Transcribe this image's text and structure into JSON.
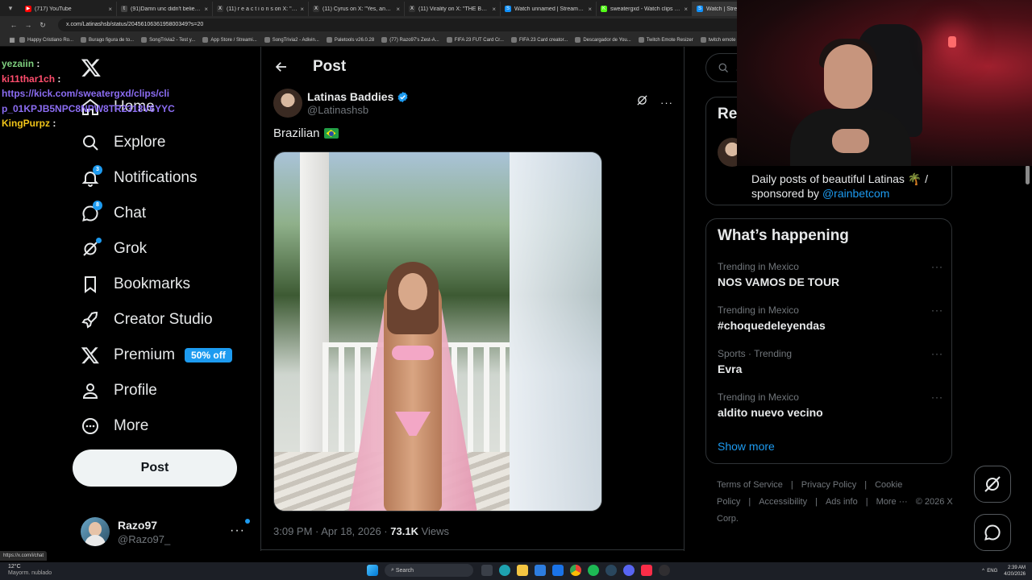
{
  "browser": {
    "tabs": [
      {
        "title": "(717) YouTube",
        "color": "#ff0000",
        "glyph": "▶"
      },
      {
        "title": "(91)Damn unc didn't believe in",
        "color": "#444444",
        "glyph": "t"
      },
      {
        "title": "(11) r e a c t i o n s on X: \"El cro",
        "color": "#333333",
        "glyph": "X"
      },
      {
        "title": "(11) Cyrus on X: \"Yes, and it'd",
        "color": "#333333",
        "glyph": "X"
      },
      {
        "title": "(11) Virality on X: \"THE BOTT",
        "color": "#333333",
        "glyph": "X"
      },
      {
        "title": "Watch unnamed | Streamable",
        "color": "#0f90fa",
        "glyph": "S"
      },
      {
        "title": "sweatergxd - Watch clips on K",
        "color": "#53fc18",
        "glyph": "K"
      },
      {
        "title": "Watch | Streama",
        "color": "#0f90fa",
        "glyph": "S"
      }
    ],
    "url": "x.com/Latinashsb/status/2045610636195800349?s=20",
    "bookmarks": [
      "Happy Cristiano Ro...",
      "Burago figura de to...",
      "SongTrivia2 - Test y...",
      "App Store / Streami...",
      "SongTrivia2 - Adivin...",
      "Paletools v26.0.28",
      "(77) Razo97's Zest-A...",
      "FIFA 23 FUT Card Cr...",
      "FIFA 23 Card creator...",
      "Descargador de You...",
      "Twitch Emote Resizer",
      "twitch emote re"
    ]
  },
  "chat": {
    "messages": [
      {
        "user": "yezaiin",
        "text": ":",
        "style": "u1"
      },
      {
        "user": "ki11thar1ch",
        "text": ":",
        "style": "u2"
      },
      {
        "user": "",
        "text": "https://kick.com/sweatergxd/clips/clip_01KPJB5NPC8NPW8TR2318V6YYC",
        "style": "link"
      },
      {
        "user": "KingPurpz",
        "text": ":",
        "style": "u3"
      }
    ]
  },
  "nav": {
    "items": [
      {
        "label": "Home",
        "icon": "home-icon"
      },
      {
        "label": "Explore",
        "icon": "search-icon"
      },
      {
        "label": "Notifications",
        "icon": "bell-icon",
        "badge": "3"
      },
      {
        "label": "Chat",
        "icon": "chat-icon",
        "badge": "8"
      },
      {
        "label": "Grok",
        "icon": "grok-icon"
      },
      {
        "label": "Bookmarks",
        "icon": "bookmark-icon"
      },
      {
        "label": "Creator Studio",
        "icon": "rocket-icon"
      },
      {
        "label": "Premium",
        "icon": "x-icon",
        "pill": "50% off"
      },
      {
        "label": "Profile",
        "icon": "person-icon"
      },
      {
        "label": "More",
        "icon": "more-circle-icon"
      }
    ],
    "post_button": "Post",
    "account": {
      "name": "Razo97",
      "handle": "@Razo97_"
    }
  },
  "post": {
    "header_title": "Post",
    "author_name": "Latinas Baddies",
    "author_handle": "@Latinashsb",
    "text": "Brazilian",
    "time": "3:09 PM · Apr 18, 2026 ·",
    "views_count": "73.1K",
    "views_label": "Views"
  },
  "right": {
    "search_placeholder": "Se",
    "relevant_title": "Rel",
    "bio_text": "Daily posts of beautiful Latinas 🌴 / sponsored by",
    "bio_link": "@rainbetcom",
    "happening_title": "What’s happening",
    "trends": [
      {
        "context": "Trending in Mexico",
        "name": "NOS VAMOS DE TOUR"
      },
      {
        "context": "Trending in Mexico",
        "name": "#choquedeleyendas"
      },
      {
        "context": "Sports · Trending",
        "name": "Evra"
      },
      {
        "context": "Trending in Mexico",
        "name": "aldito nuevo vecino"
      }
    ],
    "show_more": "Show more",
    "footer_links": [
      "Terms of Service",
      "|",
      "Privacy Policy",
      "|",
      "Cookie Policy",
      "|",
      "Accessibility",
      "|",
      "Ads info",
      "|",
      "More ···",
      "© 2026 X Corp."
    ]
  },
  "taskbar": {
    "weather_temp": "12°C",
    "weather_desc": "Mayorm. nublado",
    "search_label": "Search",
    "lang": "ENG",
    "time": "2:39 AM",
    "date": "4/20/2026",
    "status_url": "https://x.com/i/chat"
  },
  "colors": {
    "accent": "#1d9bf0",
    "background": "#000000",
    "border": "#2f3336",
    "muted": "#71767b"
  }
}
